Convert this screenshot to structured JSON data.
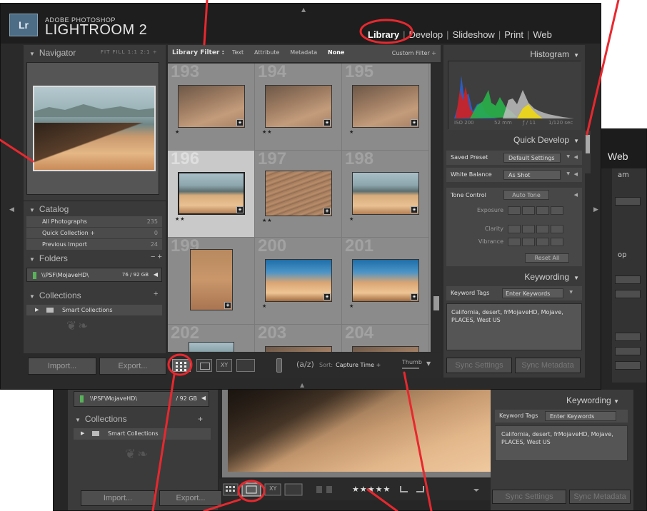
{
  "front": {
    "logo": "Lr",
    "brand_small": "ADOBE PHOTOSHOP",
    "brand_big": "LIGHTROOM 2",
    "modules": [
      "Library",
      "Develop",
      "Slideshow",
      "Print",
      "Web"
    ],
    "active_module": "Library",
    "navigator": {
      "title": "Navigator",
      "zoom_options": "FIT FILL 1:1 2:1 ÷"
    },
    "catalog": {
      "title": "Catalog",
      "items": [
        {
          "label": "All Photographs",
          "count": "235"
        },
        {
          "label": "Quick Collection +",
          "count": "0"
        },
        {
          "label": "Previous Import",
          "count": "24"
        }
      ]
    },
    "folders": {
      "title": "Folders",
      "controls": "− +",
      "item": "\\\\PSF\\MojaveHD\\",
      "size": "76 / 92 GB"
    },
    "collections": {
      "title": "Collections",
      "plus": "+",
      "item": "Smart Collections"
    },
    "buttons": {
      "import": "Import...",
      "export": "Export..."
    },
    "library_filter": {
      "label": "Library Filter :",
      "options": [
        "Text",
        "Attribute",
        "Metadata",
        "None"
      ],
      "preset": "Custom Filter ÷"
    },
    "grid": [
      {
        "num": "193",
        "stars": "★",
        "thumb": "t-sand"
      },
      {
        "num": "194",
        "stars": "★★",
        "thumb": "t-sand"
      },
      {
        "num": "195",
        "stars": "★",
        "thumb": "t-sand"
      },
      {
        "num": "196",
        "stars": "★★",
        "thumb": "t-dune",
        "selected": true
      },
      {
        "num": "197",
        "stars": "★★",
        "thumb": "t-ripple"
      },
      {
        "num": "198",
        "stars": "★",
        "thumb": "t-dune"
      },
      {
        "num": "199",
        "stars": "",
        "thumb": "t-tall"
      },
      {
        "num": "200",
        "stars": "★",
        "thumb": "t-blue"
      },
      {
        "num": "201",
        "stars": "★",
        "thumb": "t-blue"
      },
      {
        "num": "202",
        "stars": "",
        "thumb": "t-dune"
      },
      {
        "num": "203",
        "stars": "",
        "thumb": "t-sand"
      },
      {
        "num": "204",
        "stars": "",
        "thumb": "t-sand"
      }
    ],
    "toolbar": {
      "xy": "XY",
      "az": "(a/z)",
      "sort_label": "Sort:",
      "sort_value": "Capture Time ÷",
      "thumbnails": "Thumb"
    },
    "histogram": {
      "title": "Histogram",
      "iso": "ISO 200",
      "focal": "52 mm",
      "aperture": "ƒ / 11",
      "shutter": "1/120 sec"
    },
    "quick_develop": {
      "title": "Quick Develop",
      "saved_preset": {
        "label": "Saved Preset",
        "value": "Default Settings"
      },
      "white_balance": {
        "label": "White Balance",
        "value": "As Shot"
      },
      "tone_control": {
        "label": "Tone Control",
        "auto": "Auto Tone"
      },
      "adjust": [
        "Exposure",
        "Clarity",
        "Vibrance"
      ],
      "reset": "Reset All"
    },
    "keywording": {
      "title": "Keywording",
      "tags_label": "Keyword Tags",
      "tags_mode": "Enter Keywords",
      "keywords": "California, desert, frMojaveHD, Mojave, PLACES, West US"
    },
    "sync": {
      "settings": "Sync Settings",
      "metadata": "Sync Metadata"
    }
  },
  "back": {
    "web": "Web",
    "fragments": [
      "am",
      "op"
    ],
    "folder_item": "\\\\PSF\\MojaveHD\\",
    "folder_size": "/ 92 GB",
    "collections": "Collections",
    "smart": "Smart Collections",
    "buttons": {
      "import": "Import...",
      "export": "Export..."
    },
    "keywording": "Keywording",
    "tags_label": "Keyword Tags",
    "tags_mode": "Enter Keywords",
    "keywords": "California, desert, frMojaveHD, Mojave, PLACES, West US",
    "xy": "XY",
    "sync": {
      "settings": "Sync Settings",
      "metadata": "Sync Metadata"
    },
    "rating": "★★★★★"
  },
  "colors": {
    "annotation": "#e8282e",
    "panel": "#3a3a3a",
    "selected_cell": "#c9c9c9"
  }
}
